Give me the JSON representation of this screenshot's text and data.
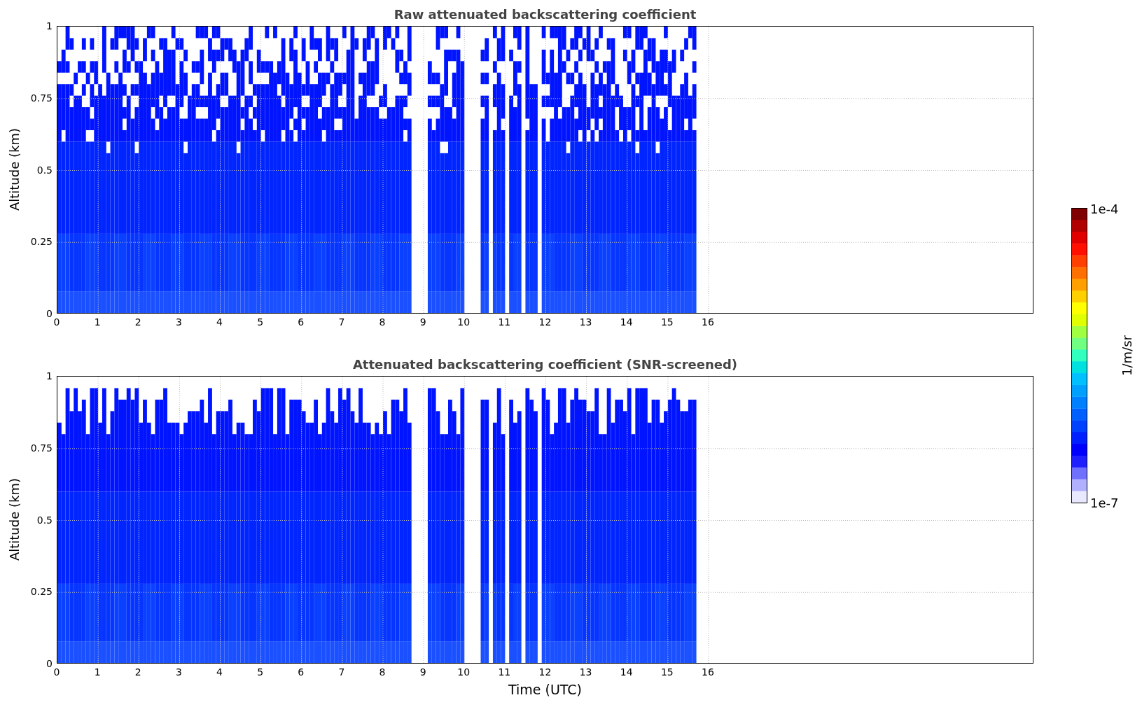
{
  "panels": [
    {
      "kind": "raw",
      "title": "Raw attenuated backscattering coefficient",
      "ylabel": "Altitude (km)",
      "yticks": [
        "1",
        "0.75",
        "0.5",
        "0.25",
        "0"
      ],
      "xticks": [
        "0",
        "1",
        "2",
        "3",
        "4",
        "5",
        "6",
        "7",
        "8",
        "9",
        "10",
        "11",
        "12",
        "13",
        "14",
        "15",
        "16"
      ]
    },
    {
      "kind": "screened",
      "title": "Attenuated backscattering coefficient (SNR-screened)",
      "ylabel": "Altitude (km)",
      "yticks": [
        "1",
        "0.75",
        "0.5",
        "0.25",
        "0"
      ],
      "xticks": [
        "0",
        "1",
        "2",
        "3",
        "4",
        "5",
        "6",
        "7",
        "8",
        "9",
        "10",
        "11",
        "12",
        "13",
        "14",
        "15",
        "16"
      ]
    }
  ],
  "xlabel": "Time (UTC)",
  "colorbar": {
    "max": "1e-4",
    "min": "1e-7",
    "label": "1/m/sr"
  }
}
